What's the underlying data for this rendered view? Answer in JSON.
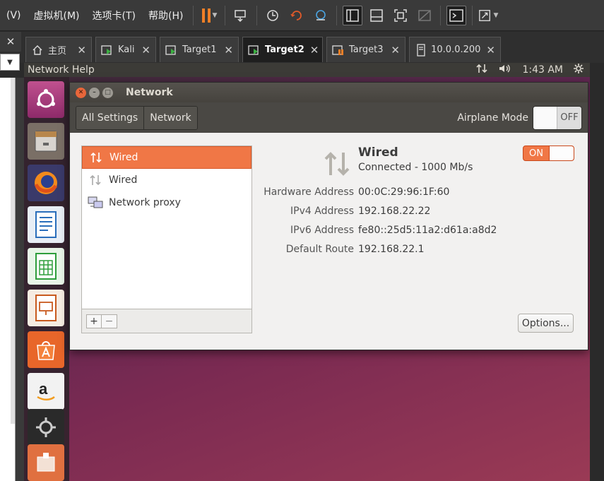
{
  "vmware": {
    "menus": [
      "(V)",
      "虚拟机(M)",
      "选项卡(T)",
      "帮助(H)"
    ],
    "tabs": [
      {
        "label": "主页",
        "icon": "home-icon"
      },
      {
        "label": "Kali",
        "icon": "vm-running-icon"
      },
      {
        "label": "Target1",
        "icon": "vm-running-icon"
      },
      {
        "label": "Target2",
        "icon": "vm-running-icon",
        "active": true
      },
      {
        "label": "Target3",
        "icon": "vm-paused-icon"
      },
      {
        "label": "10.0.0.200",
        "icon": "vm-server-icon"
      }
    ],
    "close_symbol": "✕"
  },
  "ubuntu_panel": {
    "app_menu": "Network Help",
    "time": "1:43 AM"
  },
  "window": {
    "title": "Network",
    "breadcrumbs": [
      "All Settings",
      "Network"
    ],
    "airplane_label": "Airplane Mode",
    "airplane_state": "OFF"
  },
  "devices": [
    {
      "label": "Wired",
      "icon": "network-arrows-icon",
      "selected": true
    },
    {
      "label": "Wired",
      "icon": "network-arrows-icon",
      "selected": false
    },
    {
      "label": "Network proxy",
      "icon": "network-proxy-icon",
      "selected": false
    }
  ],
  "list_buttons": {
    "add": "+",
    "remove": "−"
  },
  "detail": {
    "name": "Wired",
    "status": "Connected - 1000 Mb/s",
    "toggle": "ON",
    "properties": [
      {
        "label": "Hardware Address",
        "value": "00:0C:29:96:1F:60"
      },
      {
        "label": "IPv4 Address",
        "value": "192.168.22.22"
      },
      {
        "label": "IPv6 Address",
        "value": "fe80::25d5:11a2:d61a:a8d2"
      },
      {
        "label": "Default Route",
        "value": "192.168.22.1"
      }
    ],
    "options_label": "Options..."
  },
  "colors": {
    "accent": "#f07746",
    "panel": "#3c3b37"
  }
}
